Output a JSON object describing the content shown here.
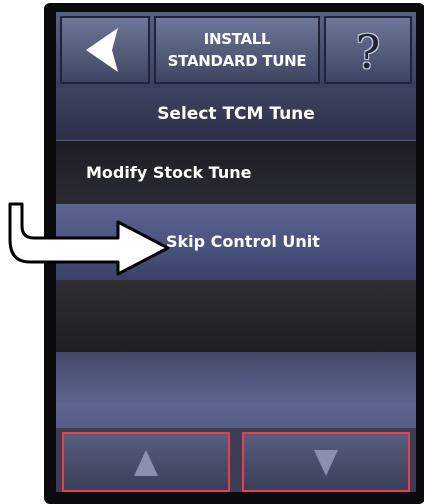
{
  "header": {
    "title_line1": "INSTALL",
    "title_line2": "STANDARD TUNE",
    "help_glyph": "?",
    "back_icon": "back-arrow-icon",
    "help_icon": "help-question-icon"
  },
  "list": {
    "title": "Select TCM Tune",
    "items": [
      {
        "label": "Modify Stock Tune"
      },
      {
        "label": "Skip Control Unit"
      }
    ]
  },
  "footer": {
    "up_icon": "up-triangle-icon",
    "down_icon": "down-triangle-icon"
  },
  "colors": {
    "accent_border": "#e8404a",
    "highlight_row": "#4a5380",
    "screen_bg": "#30324a"
  }
}
